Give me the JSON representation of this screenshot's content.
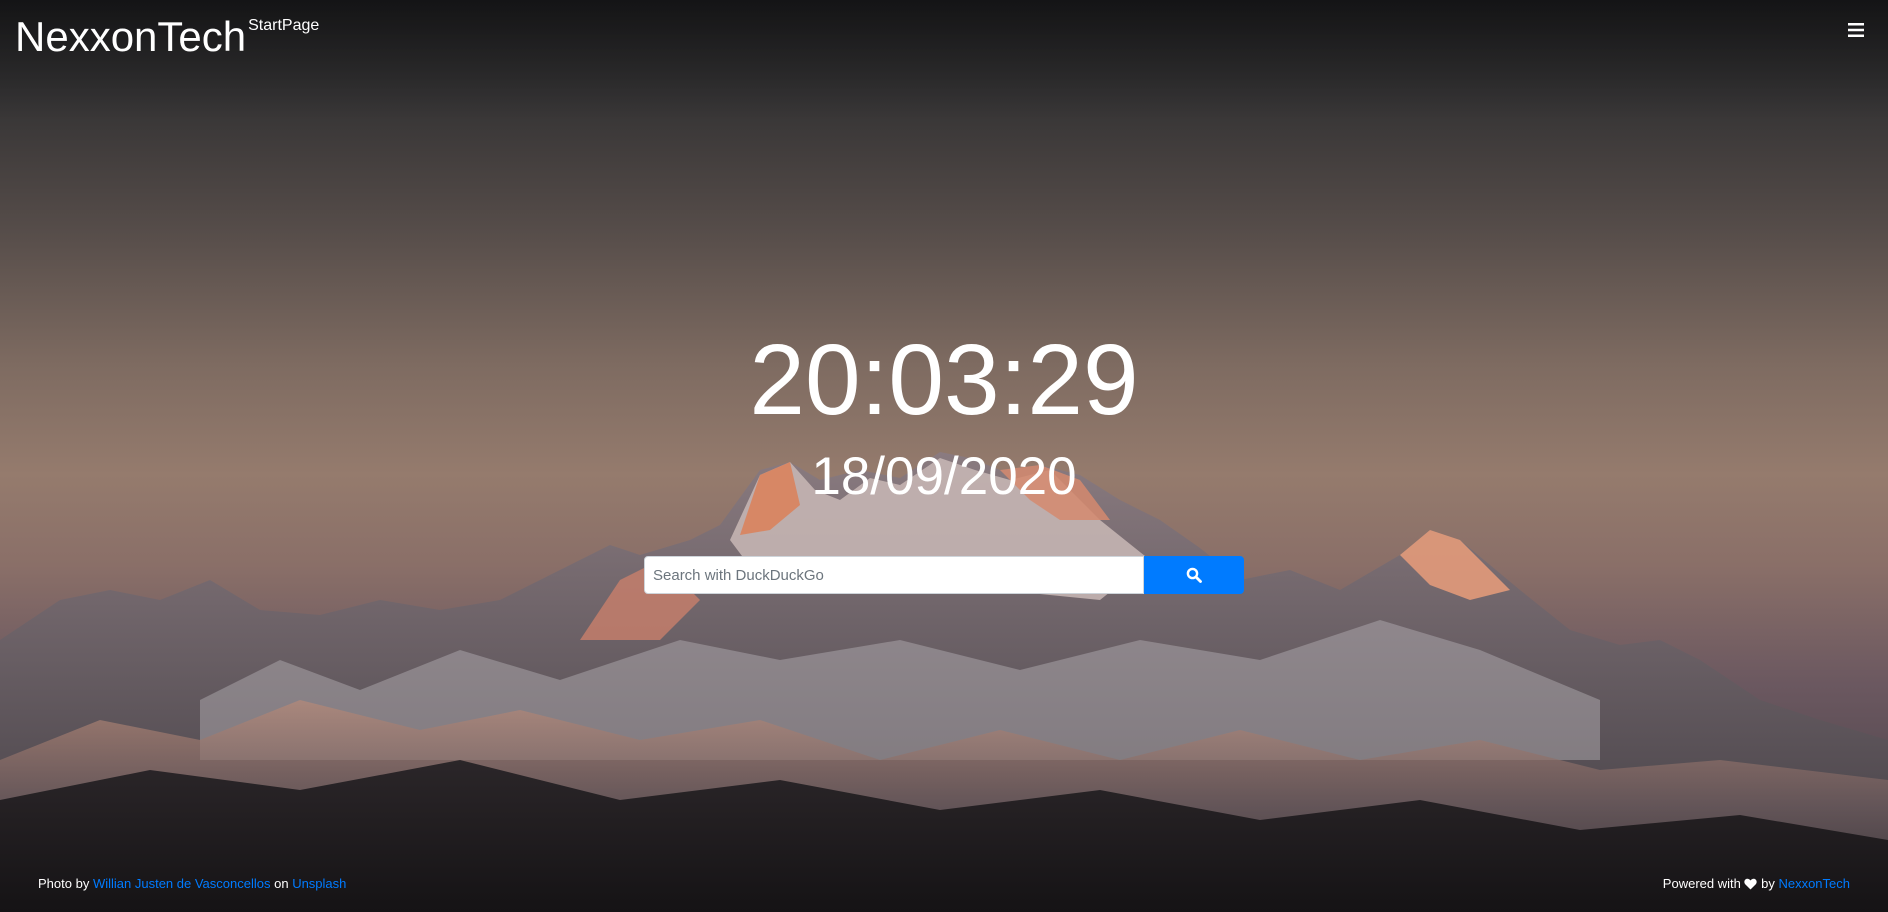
{
  "header": {
    "brand_name": "NexxonTech",
    "brand_suffix": "StartPage",
    "menu_icon": "hamburger-menu-icon"
  },
  "main": {
    "time": "20:03:29",
    "date": "18/09/2020"
  },
  "search": {
    "placeholder": "Search with DuckDuckGo",
    "value": "",
    "button_icon": "search-icon"
  },
  "footer": {
    "photo_prefix": "Photo by",
    "photographer": "Willian Justen de Vasconcellos",
    "on_text": "on",
    "source": "Unsplash",
    "powered_prefix": "Powered with",
    "heart_icon": "heart-icon",
    "by_text": "by",
    "powered_by": "NexxonTech"
  },
  "colors": {
    "accent": "#007bff",
    "text": "#ffffff"
  }
}
